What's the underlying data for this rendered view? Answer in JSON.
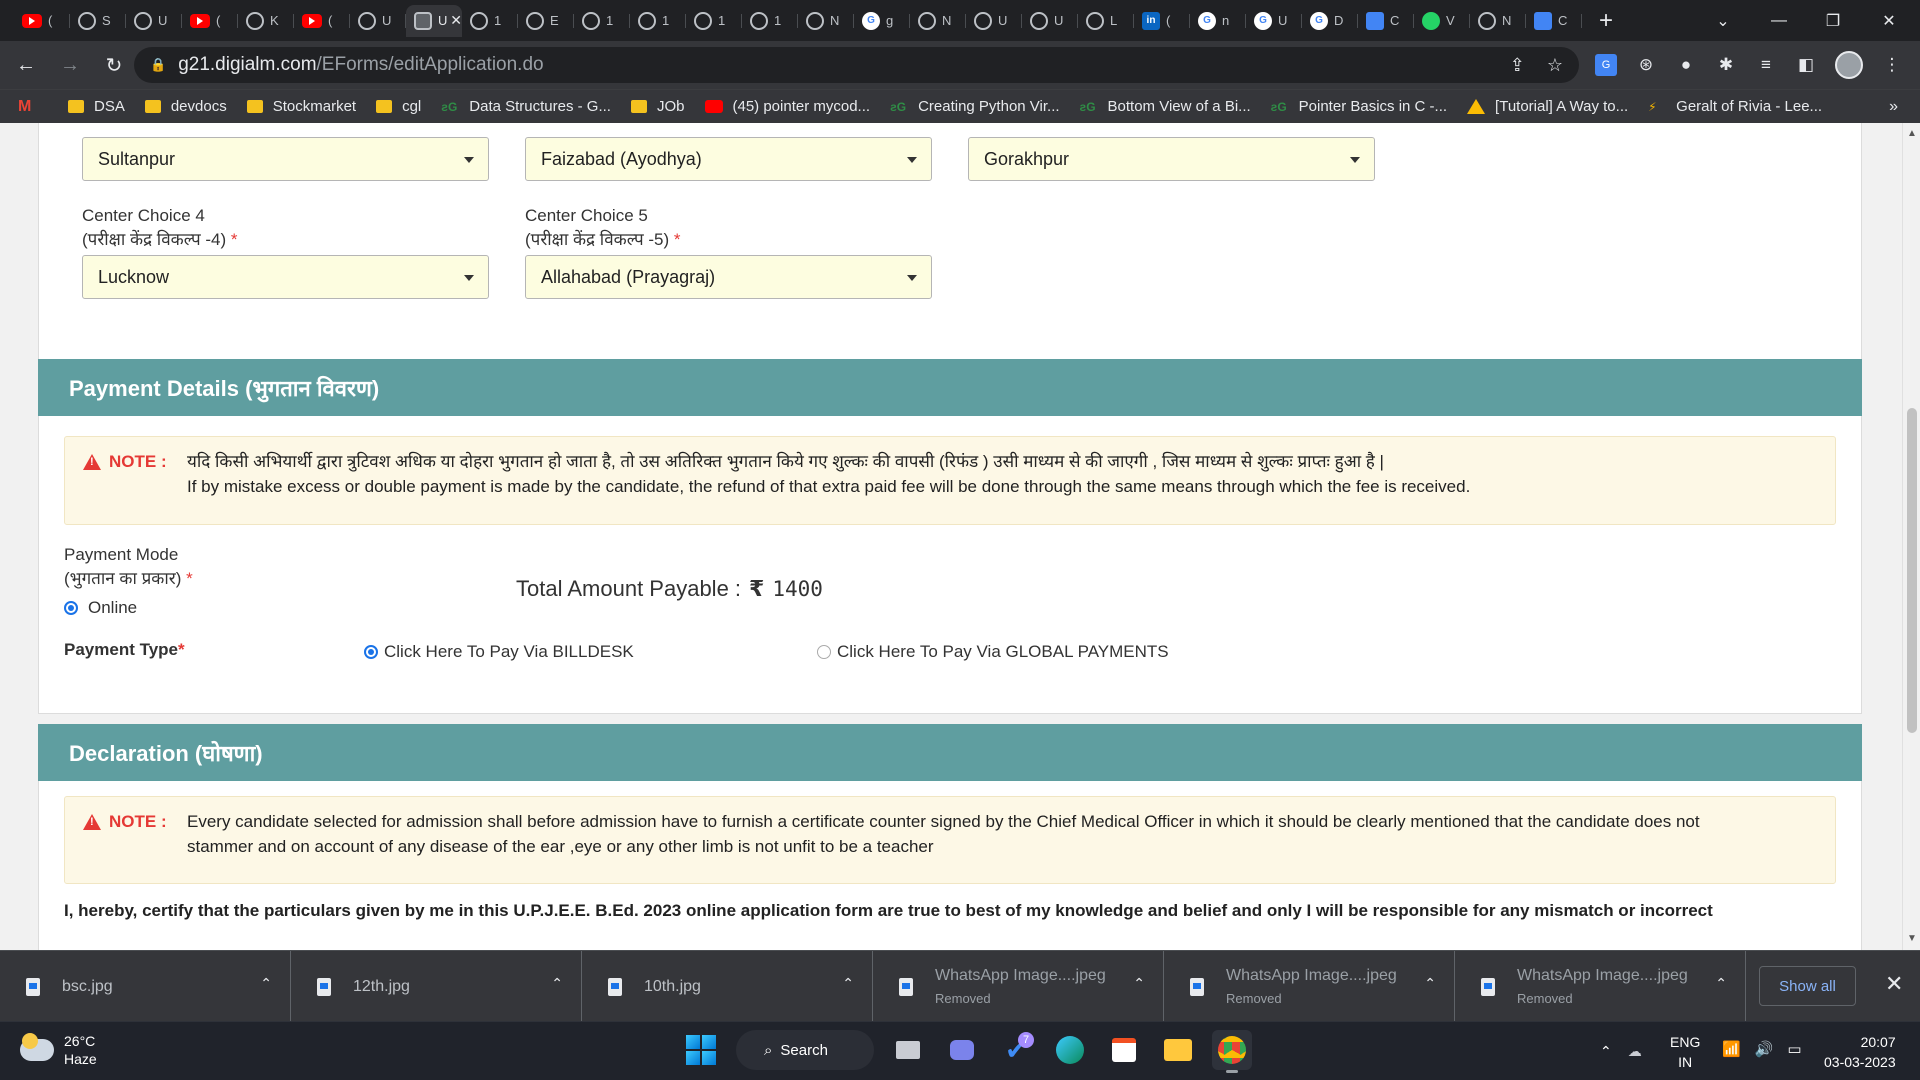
{
  "browser": {
    "tabs": [
      {
        "icon": "youtube-icon",
        "label": "("
      },
      {
        "icon": "globe-icon",
        "label": "S"
      },
      {
        "icon": "globe-icon",
        "label": "U"
      },
      {
        "icon": "youtube-icon",
        "label": "("
      },
      {
        "icon": "globe-icon",
        "label": "K"
      },
      {
        "icon": "youtube-icon",
        "label": "("
      },
      {
        "icon": "globe-icon",
        "label": "U"
      },
      {
        "icon": "page-icon",
        "label": "U"
      },
      {
        "icon": "globe-icon",
        "label": "1"
      },
      {
        "icon": "globe-icon",
        "label": "E"
      },
      {
        "icon": "globe-icon",
        "label": "1"
      },
      {
        "icon": "globe-icon",
        "label": "1"
      },
      {
        "icon": "globe-icon",
        "label": "1"
      },
      {
        "icon": "globe-icon",
        "label": "1"
      },
      {
        "icon": "globe-icon",
        "label": "N"
      },
      {
        "icon": "google-icon",
        "label": "g"
      },
      {
        "icon": "globe-icon",
        "label": "N"
      },
      {
        "icon": "globe-icon",
        "label": "U"
      },
      {
        "icon": "globe-icon",
        "label": "U"
      },
      {
        "icon": "globe-icon",
        "label": "L"
      },
      {
        "icon": "linkedin-icon",
        "label": "("
      },
      {
        "icon": "google-icon",
        "label": "n"
      },
      {
        "icon": "google-icon",
        "label": "U"
      },
      {
        "icon": "google-icon",
        "label": "D"
      },
      {
        "icon": "translate-icon",
        "label": "C"
      },
      {
        "icon": "whatsapp-icon",
        "label": "V"
      },
      {
        "icon": "chrome-icon",
        "label": "N"
      },
      {
        "icon": "translate-icon",
        "label": "C"
      }
    ],
    "active_tab_index": 7,
    "url_host": "g21.digialm.com",
    "url_path": "/EForms/editApplication.do",
    "bookmarks": [
      {
        "icon": "gmail-icon",
        "label": ""
      },
      {
        "icon": "folder-icon",
        "label": "DSA"
      },
      {
        "icon": "folder-icon",
        "label": "devdocs"
      },
      {
        "icon": "folder-icon",
        "label": "Stockmarket"
      },
      {
        "icon": "folder-icon",
        "label": "cgl"
      },
      {
        "icon": "gfg-icon",
        "label": "Data Structures - G..."
      },
      {
        "icon": "folder-icon",
        "label": "JOb"
      },
      {
        "icon": "youtube-icon",
        "label": "(45) pointer mycod..."
      },
      {
        "icon": "gfg-icon",
        "label": "Creating Python Vir..."
      },
      {
        "icon": "gfg-icon",
        "label": "Bottom View of a Bi..."
      },
      {
        "icon": "gfg-icon",
        "label": "Pointer Basics in C -..."
      },
      {
        "icon": "drive-icon",
        "label": "[Tutorial] A Way to..."
      },
      {
        "icon": "mi-icon",
        "label": "Geralt of Rivia - Lee..."
      }
    ]
  },
  "centers": {
    "choice1": {
      "value": "Sultanpur"
    },
    "choice2": {
      "value": "Faizabad (Ayodhya)"
    },
    "choice3": {
      "value": "Gorakhpur"
    },
    "choice4": {
      "label": "Center Choice 4",
      "label_hi": "(परीक्षा केंद्र विकल्प -4)",
      "value": "Lucknow"
    },
    "choice5": {
      "label": "Center Choice 5",
      "label_hi": "(परीक्षा केंद्र विकल्प -5)",
      "value": "Allahabad (Prayagraj)"
    },
    "required_mark": "*"
  },
  "payment": {
    "title": "Payment Details (भुगतान विवरण)",
    "note_label": "NOTE :",
    "note_hi": "यदि किसी अभियार्थी द्वारा त्रुटिवश अधिक या दोहरा भुगतान हो जाता है, तो उस अतिरिक्त भुगतान किये गए शुल्कः की वापसी (रिफंड ) उसी माध्यम से की जाएगी , जिस माध्यम से शुल्कः प्राप्तः हुआ है |",
    "note_en": "If by mistake excess or double payment is made by the candidate, the refund of that extra paid fee will be done through the same means through which the fee is received.",
    "mode_label": "Payment Mode",
    "mode_label_hi": "(भुगतान का प्रकार)",
    "mode_option": "Online",
    "total_label": "Total Amount Payable :",
    "currency": "₹",
    "amount": "1400",
    "type_label": "Payment Type",
    "option_billdesk": "Click Here To Pay Via BILLDESK",
    "option_global": "Click Here To Pay Via GLOBAL PAYMENTS"
  },
  "declaration": {
    "title": "Declaration (घोषणा)",
    "note_label": "NOTE :",
    "note_line1": "Every candidate selected for admission shall before admission have to furnish a certificate counter signed by the Chief Medical Officer in which it should be clearly mentioned that the candidate does not",
    "note_line2": "stammer and on account of any disease of the ear ,eye or any other limb is not unfit to be a teacher",
    "certify_text": "I, hereby, certify that the particulars given by me in this U.P.J.E.E. B.Ed. 2023  online application form are true to best of my knowledge and belief and only I will be responsible for any mismatch or incorrect"
  },
  "downloads": {
    "items": [
      {
        "name": "bsc.jpg",
        "status": ""
      },
      {
        "name": "12th.jpg",
        "status": ""
      },
      {
        "name": "10th.jpg",
        "status": ""
      },
      {
        "name": "WhatsApp Image....jpeg",
        "status": "Removed"
      },
      {
        "name": "WhatsApp Image....jpeg",
        "status": "Removed"
      },
      {
        "name": "WhatsApp Image....jpeg",
        "status": "Removed"
      }
    ],
    "show_all": "Show all"
  },
  "taskbar": {
    "temperature": "26°C",
    "weather": "Haze",
    "search": "Search",
    "chat_badge": "7",
    "lang_top": "ENG",
    "lang_bottom": "IN",
    "time": "20:07",
    "date": "03-03-2023"
  },
  "colors": {
    "section_header": "#5f9ea0",
    "select_bg": "#fdfde0",
    "note_bg": "#fdf8e6",
    "required": "#e53935",
    "browser_dark": "#35363a"
  }
}
